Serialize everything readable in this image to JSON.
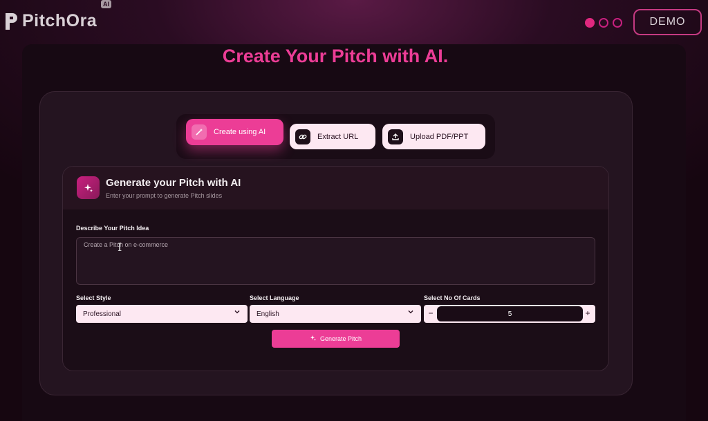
{
  "app": {
    "logo_text": "PitchOra",
    "logo_badge": "AI"
  },
  "header": {
    "demo_label": "DEMO"
  },
  "page": {
    "title": "Create Your Pitch with AI."
  },
  "tabs": [
    {
      "label": "Create using AI",
      "icon": "magic-wand-icon",
      "active": true
    },
    {
      "label": "Extract URL",
      "icon": "link-icon",
      "active": false
    },
    {
      "label": "Upload PDF/PPT",
      "icon": "upload-icon",
      "active": false
    }
  ],
  "generator": {
    "title": "Generate your Pitch with AI",
    "subtitle": "Enter your prompt to generate Pitch slides",
    "prompt_label": "Describe Your Pitch Idea",
    "prompt_value": "Create a Pitch on e-commerce",
    "style_label": "Select Style",
    "style_value": "Professional",
    "language_label": "Select Language",
    "language_value": "English",
    "cards_label": "Select No Of Cards",
    "cards_value": "5",
    "minus_label": "−",
    "plus_label": "+",
    "button_label": "Generate Pitch"
  },
  "colors": {
    "accent": "#ec3d96",
    "surface_light": "#fde8f2"
  }
}
